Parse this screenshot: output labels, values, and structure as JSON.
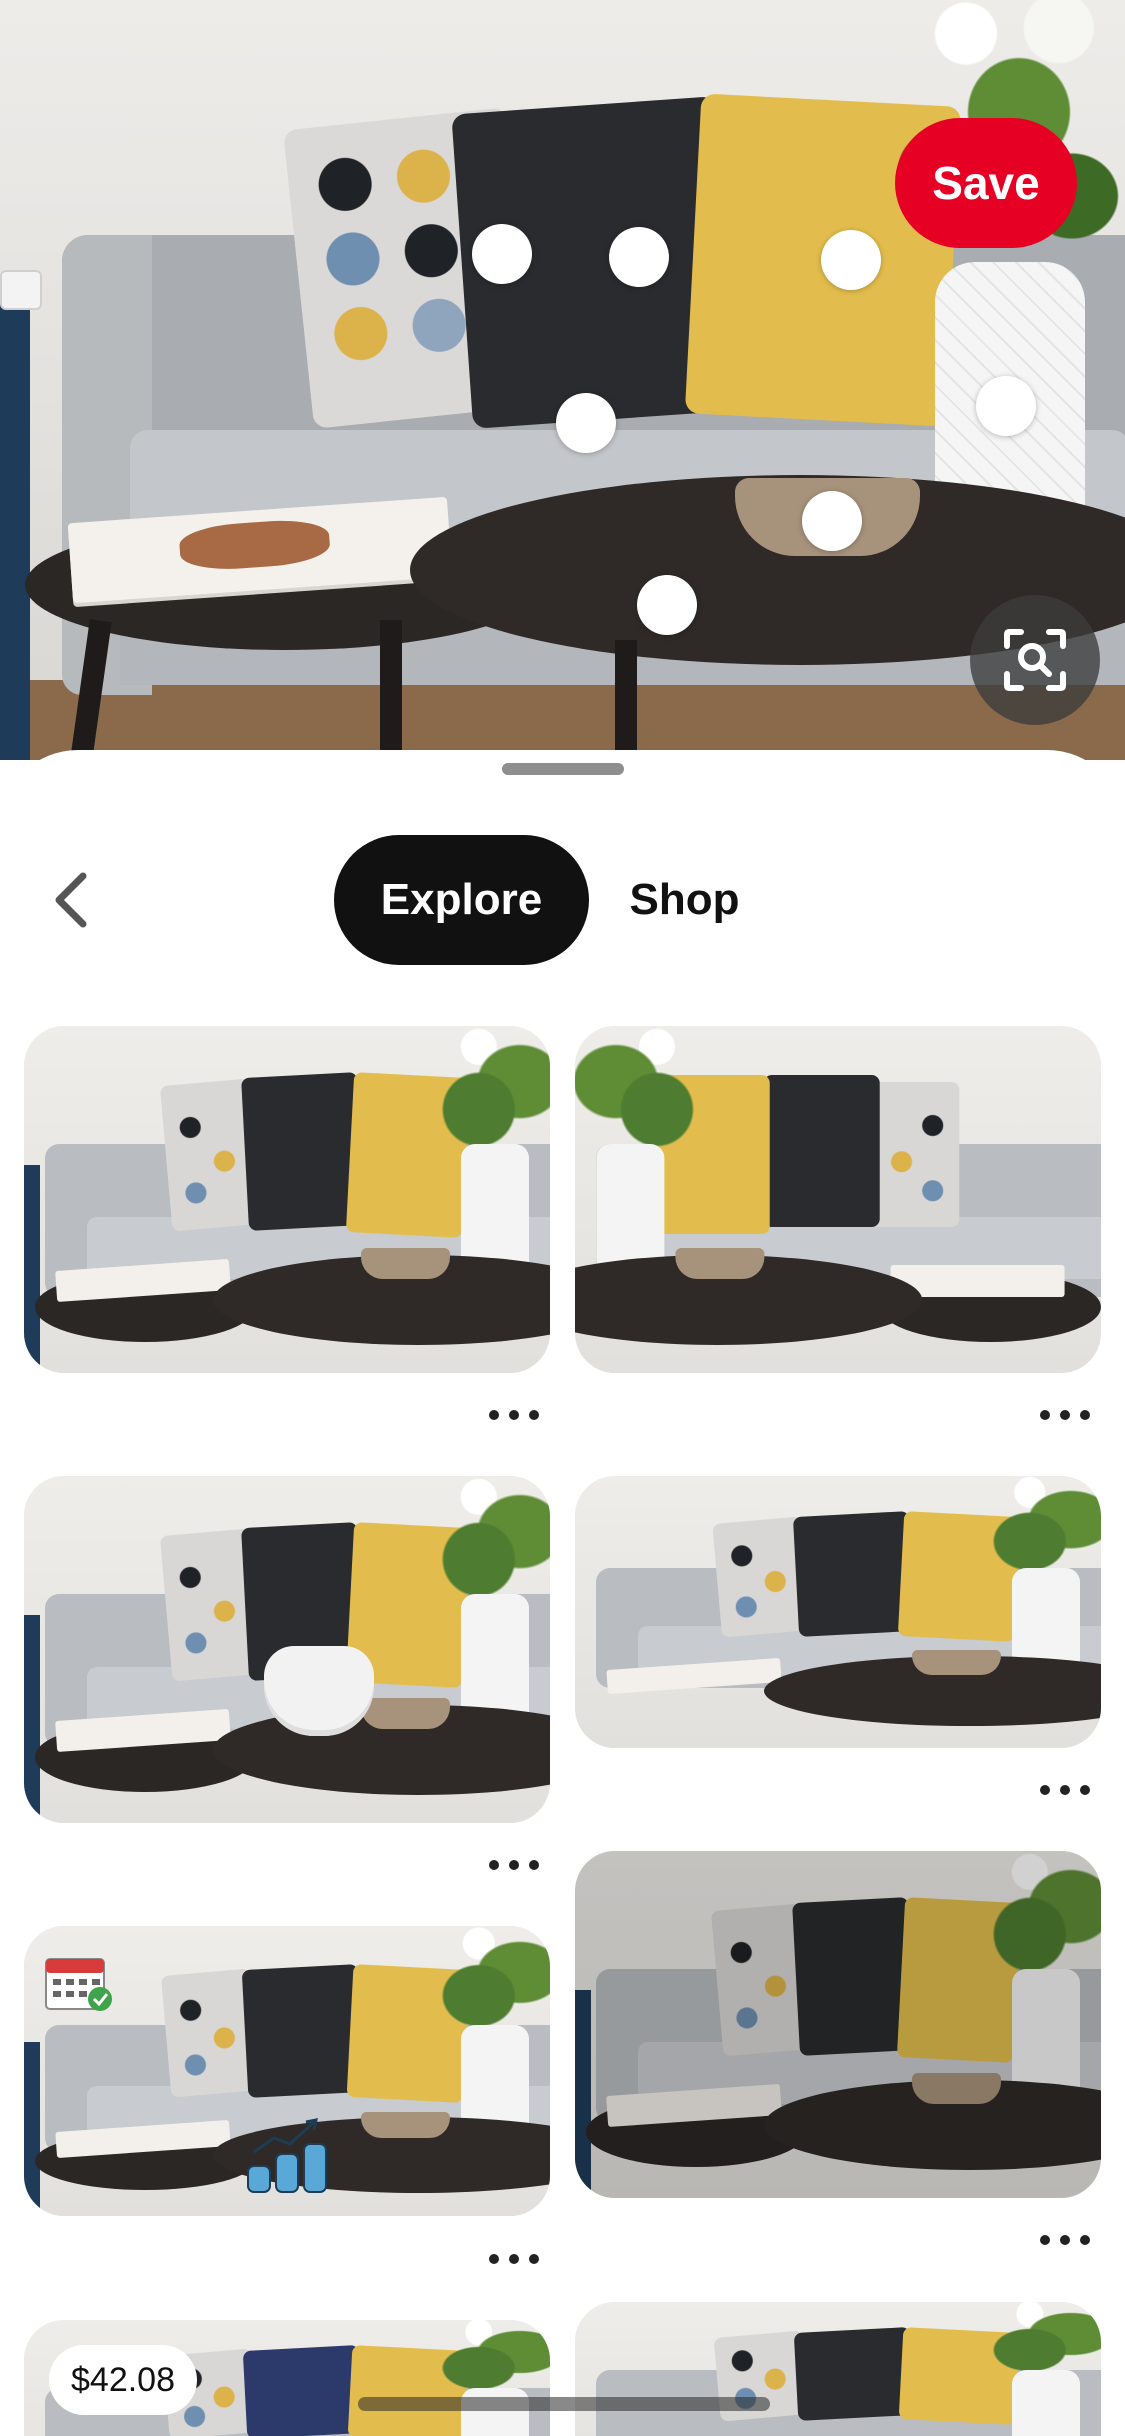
{
  "hero": {
    "save_label": "Save",
    "visual_search_icon": "scan-lens-icon",
    "hotspot_count": 8
  },
  "sheet": {
    "back_icon": "chevron-left-icon",
    "tabs": [
      {
        "label": "Explore",
        "selected": true
      },
      {
        "label": "Shop",
        "selected": false
      }
    ]
  },
  "pins": [
    {
      "id": 1,
      "more_icon": "more-dots-icon"
    },
    {
      "id": 2,
      "more_icon": "more-dots-icon"
    },
    {
      "id": 3,
      "more_icon": "more-dots-icon"
    },
    {
      "id": 4,
      "more_icon": "more-dots-icon"
    },
    {
      "id": 5,
      "more_icon": "more-dots-icon",
      "icons": [
        "calendar-check-icon",
        "coin-stack-growth-icon"
      ]
    },
    {
      "id": 6,
      "more_icon": "more-dots-icon"
    },
    {
      "id": 7,
      "price": "$42.08"
    },
    {
      "id": 8
    }
  ],
  "colors": {
    "save_red": "#e60023",
    "tab_selected_bg": "#111111",
    "sheet_bg": "#ffffff"
  }
}
